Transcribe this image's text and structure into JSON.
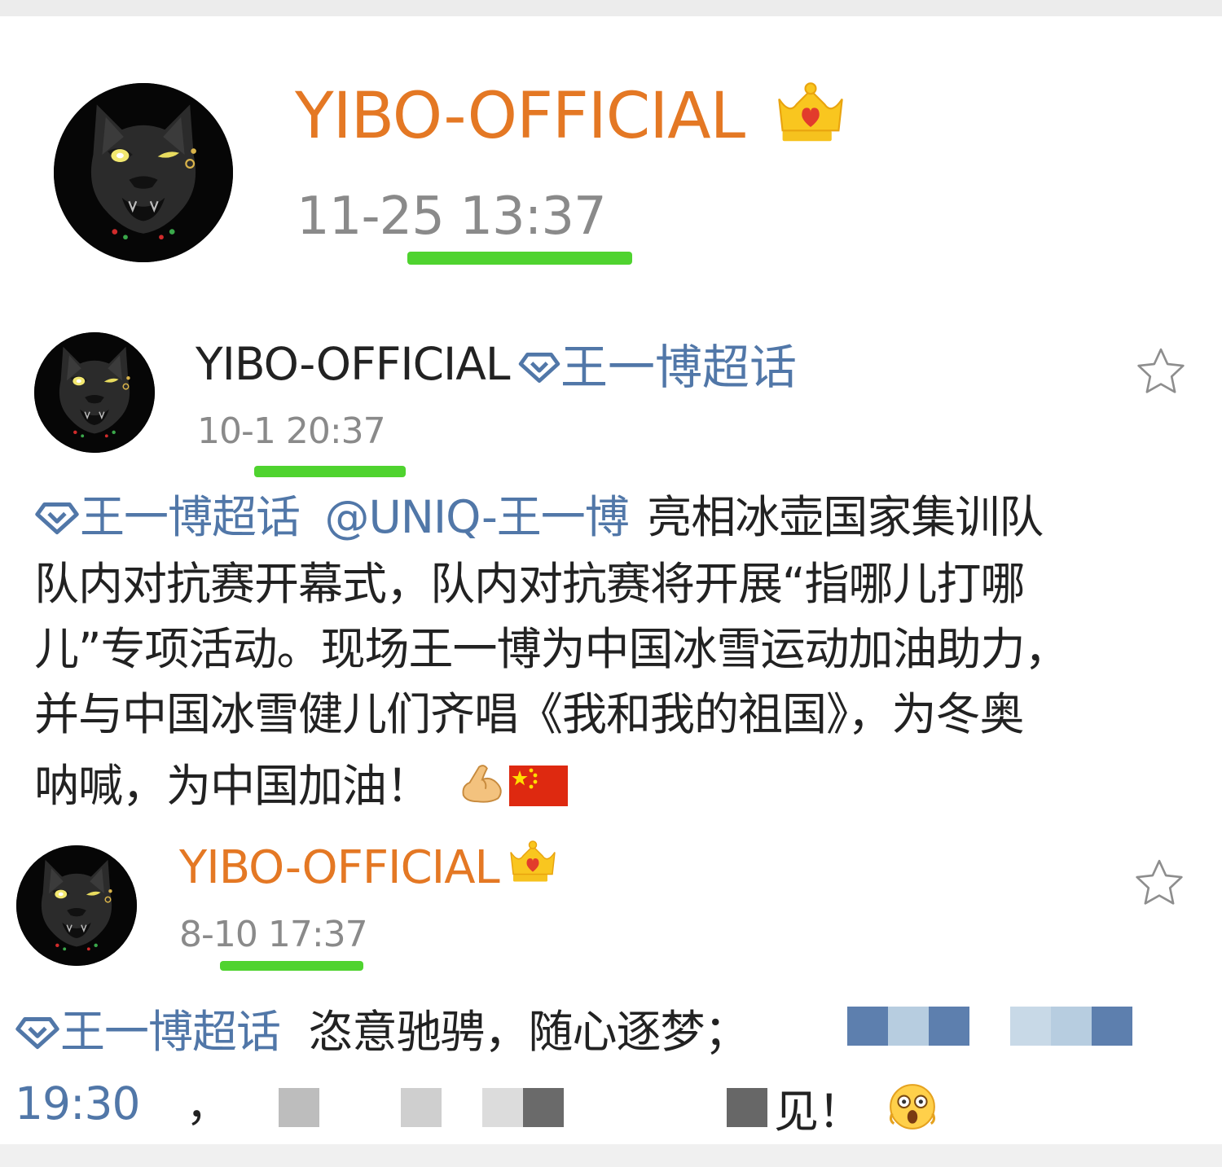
{
  "header": {
    "name": "YIBO-OFFICIAL",
    "timestamp": "11-25 13:37",
    "avatar_icon": "black-panther-avatar",
    "badge_icon": "crown-level-2-icon"
  },
  "posts": [
    {
      "name": "YIBO-OFFICIAL",
      "supertopic_label": "王一博超话",
      "timestamp": "10-1 20:37",
      "favorite_icon": "star-outline-icon",
      "body": {
        "topic": "王一博超话",
        "mention": "@UNIQ-王一博",
        "line1_rest": "亮相冰壶国家集训队",
        "line2": "队内对抗赛开幕式，队内对抗赛将开展“指哪儿打哪",
        "line3": "儿”专项活动。现场王一博为中国冰雪运动加油助力，",
        "line4": "并与中国冰雪健儿们齐唱《我和我的祖国》，为冬奥",
        "line5": "呐喊，为中国加油！"
      },
      "emojis": [
        "flexed-biceps-emoji",
        "china-flag-emoji"
      ]
    },
    {
      "name": "YIBO-OFFICIAL",
      "timestamp": "8-10 17:37",
      "badge_icon": "crown-icon",
      "favorite_icon": "star-outline-icon",
      "body": {
        "topic": "王一博超话",
        "line1_text": "恣意驰骋，随心逐梦；",
        "line2_time": "19:30",
        "line2_comma": "，",
        "line2_end": "见！"
      },
      "emojis": [
        "shocked-face-emoji"
      ]
    }
  ],
  "colors": {
    "orange_name": "#e47824",
    "link_blue": "#5177a8",
    "timestamp_gray": "#8a8a8a",
    "underline_green": "#4fd32f"
  }
}
